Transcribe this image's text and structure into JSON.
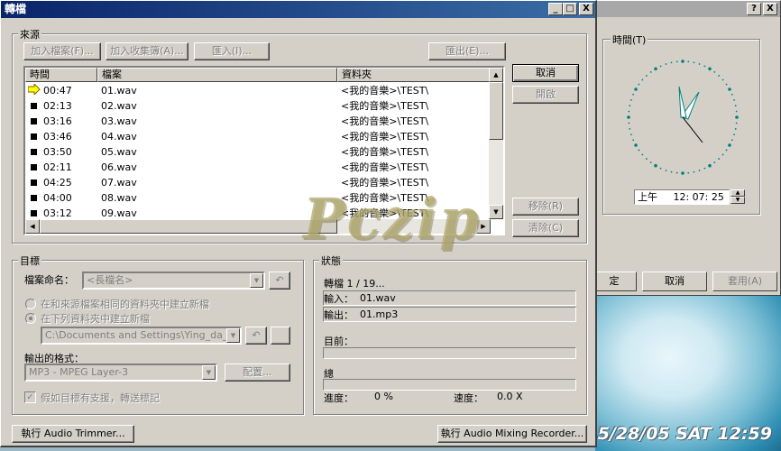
{
  "desktop": {
    "stamp_text": "5/28/05  SAT 12:59",
    "bg_dialog": {
      "help_btn": "?",
      "close_btn": "X",
      "time_label": "時間(T)",
      "time_value": "上午     12: 07: 25",
      "ok_label": "定",
      "cancel_label": "取消",
      "apply_label": "套用(A)"
    }
  },
  "window": {
    "title": "轉檔",
    "min_btn": "_",
    "max_btn": "□",
    "close_btn": "X"
  },
  "source": {
    "group_label": "來源",
    "add_files": "加入檔案(F)...",
    "add_collection": "加入收集簿(A)...",
    "import": "匯入(I)...",
    "export": "匯出(E)...",
    "columns": [
      "時間",
      "檔案",
      "資料夾"
    ],
    "rows": [
      {
        "time": "00:47",
        "file": "01.wav",
        "folder": "<我的音樂>\\TEST\\"
      },
      {
        "time": "02:13",
        "file": "02.wav",
        "folder": "<我的音樂>\\TEST\\"
      },
      {
        "time": "03:16",
        "file": "03.wav",
        "folder": "<我的音樂>\\TEST\\"
      },
      {
        "time": "03:46",
        "file": "04.wav",
        "folder": "<我的音樂>\\TEST\\"
      },
      {
        "time": "03:50",
        "file": "05.wav",
        "folder": "<我的音樂>\\TEST\\"
      },
      {
        "time": "02:11",
        "file": "06.wav",
        "folder": "<我的音樂>\\TEST\\"
      },
      {
        "time": "04:25",
        "file": "07.wav",
        "folder": "<我的音樂>\\TEST\\"
      },
      {
        "time": "04:00",
        "file": "08.wav",
        "folder": "<我的音樂>\\TEST\\"
      },
      {
        "time": "03:12",
        "file": "09.wav",
        "folder": "<我的音樂>\\TEST\\"
      }
    ],
    "cancel": "取消",
    "open": "開啟",
    "remove": "移除(R)",
    "clear": "清除(C)"
  },
  "target": {
    "group_label": "目標",
    "naming_label": "檔案命名：",
    "naming_value": "<長檔名>",
    "radio_same_folder": "在和來源檔案相同的資料夾中建立新檔",
    "radio_folder": "在下列資料夾中建立新檔",
    "folder_value": "C:\\Documents and Settings\\Ying_da_Lee\\M",
    "format_label": "輸出的格式：",
    "format_value": "MP3 - MPEG Layer-3",
    "config": "配置...",
    "checkbox_label": "假如目標有支援，轉送標記"
  },
  "status": {
    "group_label": "狀態",
    "progress_text": "轉檔 1 / 19...",
    "input_label": "輸入：",
    "input_value": "01.wav",
    "output_label": "輸出：",
    "output_value": "01.mp3",
    "current_label": "目前：",
    "total_label": "總",
    "progress_label": "進度：",
    "progress_value": "0 %",
    "speed_label": "速度：",
    "speed_value": "0.0 X"
  },
  "footer": {
    "trimmer": "執行 Audio Trimmer...",
    "mixing": "執行 Audio Mixing Recorder..."
  },
  "watermark": "Pczip"
}
